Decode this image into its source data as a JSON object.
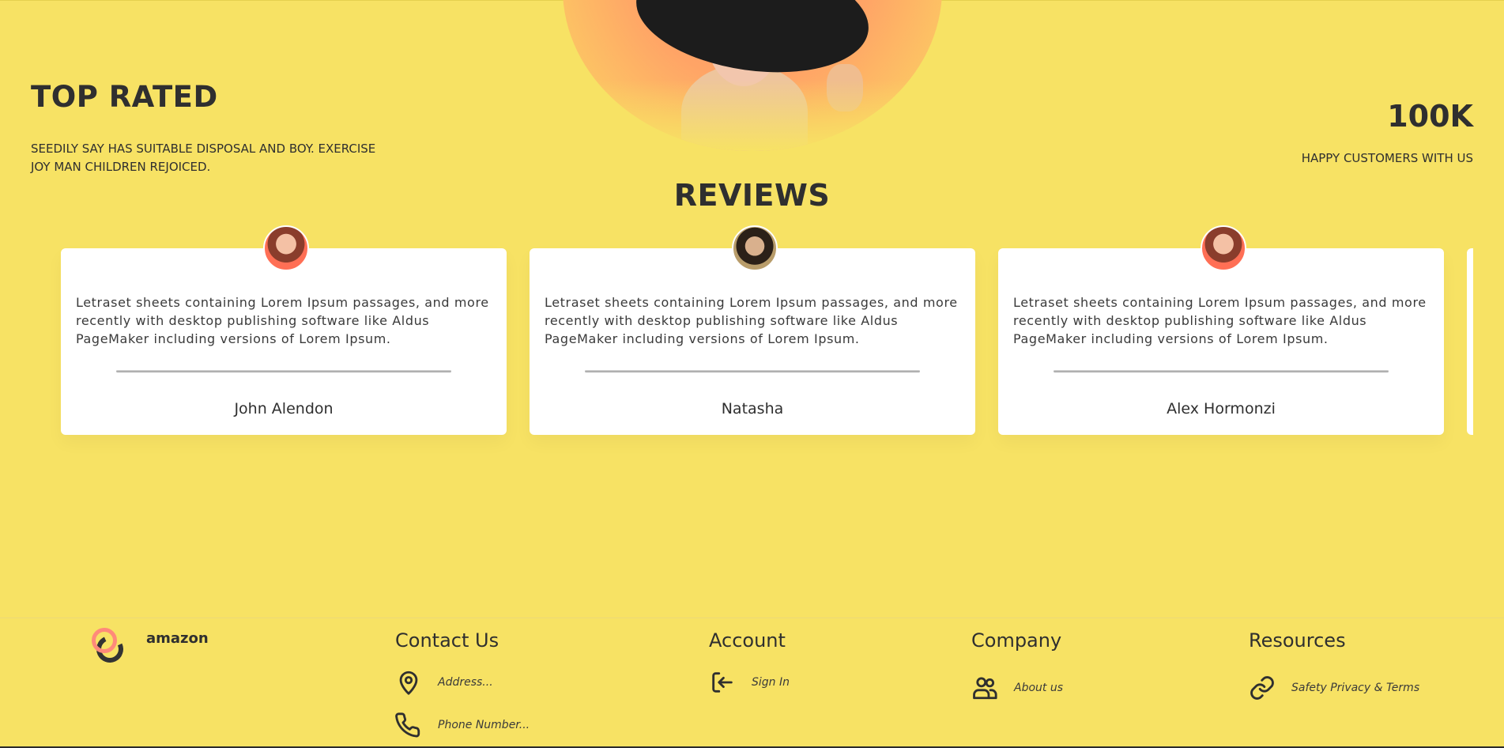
{
  "hero": {
    "title": "TOP RATED",
    "subtitle": "SEEDILY SAY HAS SUITABLE DISPOSAL AND BOY. EXERCISE JOY MAN CHILDREN REJOICED.",
    "stat_value": "100K",
    "stat_label": "HAPPY CUSTOMERS WITH US"
  },
  "reviews": {
    "title": "REVIEWS",
    "items": [
      {
        "text": "Letraset sheets containing Lorem Ipsum passages, and more recently with desktop publishing software like Aldus PageMaker including versions of Lorem Ipsum.",
        "name": "John Alendon"
      },
      {
        "text": "Letraset sheets containing Lorem Ipsum passages, and more recently with desktop publishing software like Aldus PageMaker including versions of Lorem Ipsum.",
        "name": "Natasha"
      },
      {
        "text": "Letraset sheets containing Lorem Ipsum passages, and more recently with desktop publishing software like Aldus PageMaker including versions of Lorem Ipsum.",
        "name": "Alex Hormonzi"
      }
    ]
  },
  "footer": {
    "brand": "amazon",
    "contact": {
      "title": "Contact Us",
      "address": "Address...",
      "phone": "Phone Number..."
    },
    "account": {
      "title": "Account",
      "sign_in": "Sign In"
    },
    "company": {
      "title": "Company",
      "about": "About us"
    },
    "resources": {
      "title": "Resources",
      "terms": "Safety Privacy & Terms"
    }
  },
  "icons": {
    "address": "location-pin-icon",
    "phone": "phone-icon",
    "sign_in": "sign-in-icon",
    "about": "users-icon",
    "terms": "link-icon"
  },
  "colors": {
    "background": "#f7e264",
    "text": "#2f2f2f",
    "card": "#ffffff",
    "accent": "#ff8a7a"
  }
}
